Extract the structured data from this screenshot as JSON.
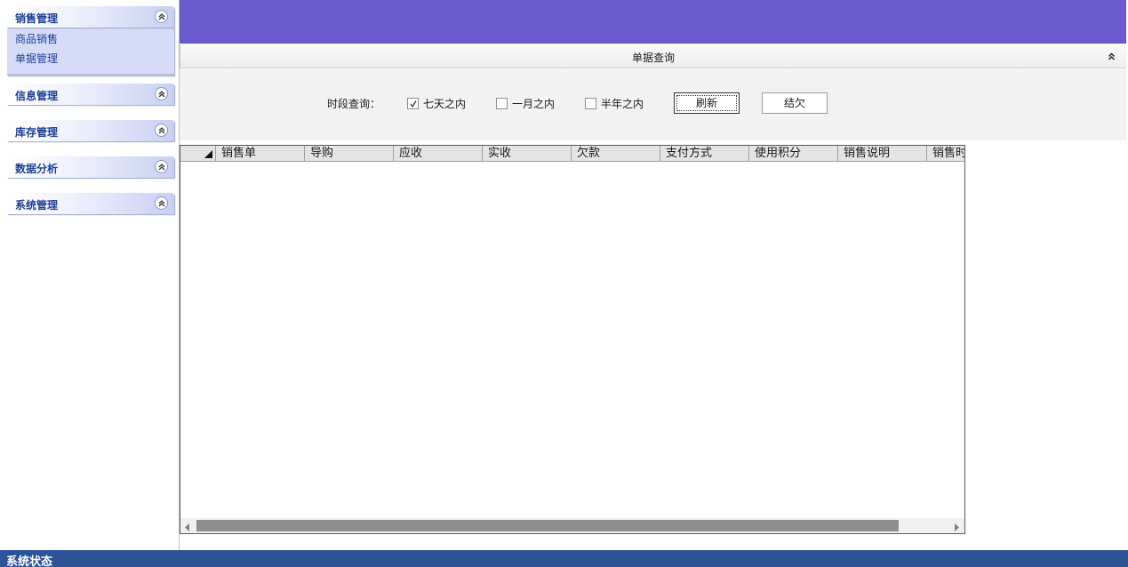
{
  "sidebar": {
    "groups": [
      {
        "title": "销售管理",
        "items": [
          "商品销售",
          "单据管理"
        ]
      },
      {
        "title": "信息管理"
      },
      {
        "title": "库存管理"
      },
      {
        "title": "数据分析"
      },
      {
        "title": "系统管理"
      }
    ]
  },
  "panel": {
    "title": "单据查询"
  },
  "filter": {
    "range_label": "时段查询：",
    "options": [
      {
        "label": "七天之内",
        "checked": true
      },
      {
        "label": "一月之内",
        "checked": false
      },
      {
        "label": "半年之内",
        "checked": false
      }
    ],
    "refresh_label": "刷新",
    "settle_label": "结欠"
  },
  "grid": {
    "columns": [
      "销售单",
      "导购",
      "应收",
      "实收",
      "欠款",
      "支付方式",
      "使用积分",
      "销售说明",
      "销售时"
    ]
  },
  "status": {
    "text": "系统状态"
  },
  "colors": {
    "topbar": "#6a5acd",
    "statusbar": "#2c5396",
    "sidebar_text": "#1f3f95"
  }
}
